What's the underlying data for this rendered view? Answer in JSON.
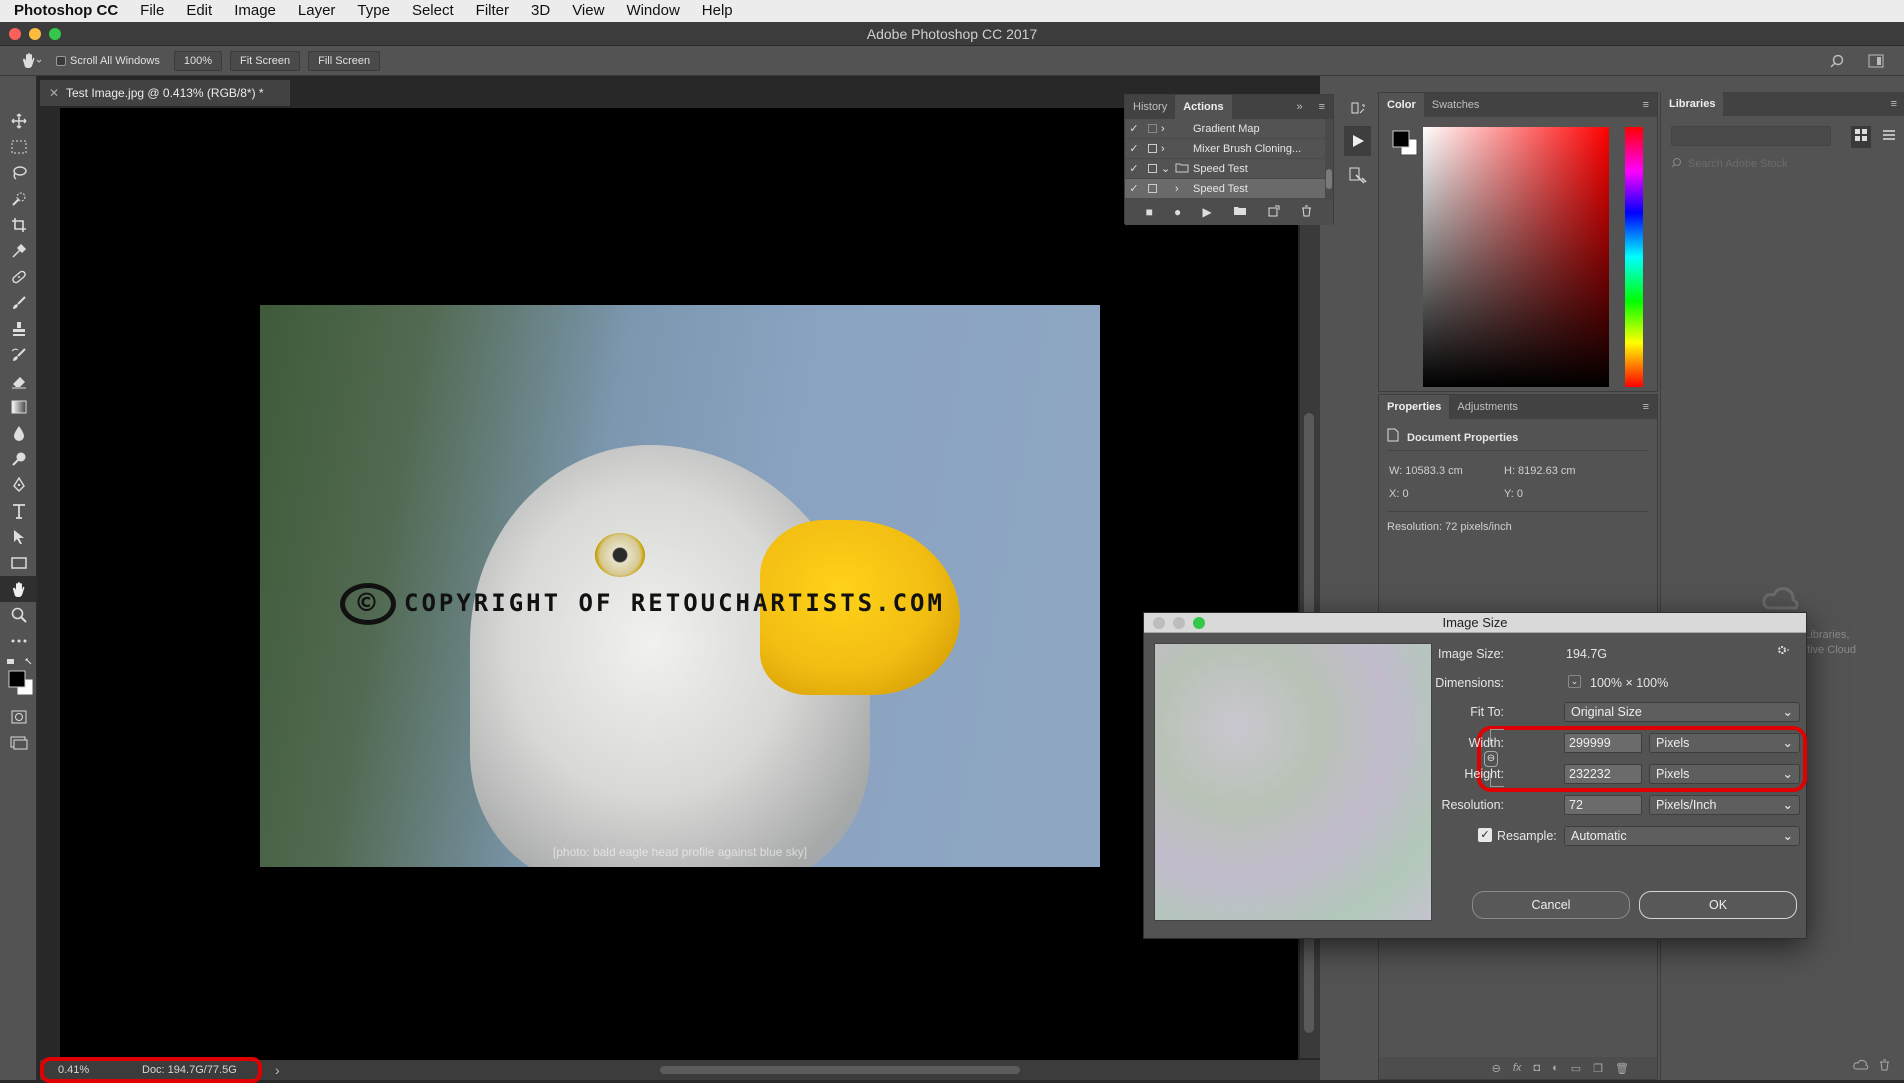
{
  "menubar": {
    "app": "Photoshop CC",
    "items": [
      "File",
      "Edit",
      "Image",
      "Layer",
      "Type",
      "Select",
      "Filter",
      "3D",
      "View",
      "Window",
      "Help"
    ]
  },
  "window": {
    "title": "Adobe Photoshop CC 2017"
  },
  "options_bar": {
    "scroll_all_windows": "Scroll All Windows",
    "zoom_100": "100%",
    "fit_screen": "Fit Screen",
    "fill_screen": "Fill Screen"
  },
  "document": {
    "tab_title": "Test Image.jpg @ 0.413% (RGB/8*) *",
    "photo_label": "[photo: bald eagle head profile against blue sky]",
    "copyright_symbol": "©",
    "copyright_text": "COPYRIGHT OF RETOUCHARTISTS.COM"
  },
  "status": {
    "zoom": "0.41%",
    "doc": "Doc: 194.7G/77.5G",
    "arrow": "›"
  },
  "actions_panel": {
    "tabs": [
      "History",
      "Actions"
    ],
    "rows": [
      {
        "label": "Gradient Map",
        "checked": true,
        "expand": "›"
      },
      {
        "label": "Mixer Brush Cloning...",
        "checked": true,
        "expand": "›"
      },
      {
        "label": "Speed Test",
        "checked": true,
        "expand": "⌄",
        "folder": true
      },
      {
        "label": "Speed Test",
        "checked": true,
        "expand": "›"
      }
    ]
  },
  "color_panel": {
    "tabs": [
      "Color",
      "Swatches"
    ]
  },
  "properties_panel": {
    "tabs": [
      "Properties",
      "Adjustments"
    ],
    "header": "Document Properties",
    "w": "W:  10583.3 cm",
    "h": "H:  8192.63 cm",
    "x": "X:  0",
    "y": "Y:  0",
    "resolution": "Resolution: 72 pixels/inch"
  },
  "libraries_panel": {
    "tab": "Libraries",
    "search_placeholder": "Search Adobe Stock",
    "cc_text_1": "d Libraries,",
    "cc_text_2": "ative Cloud"
  },
  "image_size_dialog": {
    "title": "Image Size",
    "image_size_label": "Image Size:",
    "image_size_value": "194.7G",
    "dimensions_label": "Dimensions:",
    "dimensions_value": "100%  ×  100%",
    "fit_to_label": "Fit To:",
    "fit_to_value": "Original Size",
    "width_label": "Width:",
    "width_value": "299999",
    "width_unit": "Pixels",
    "height_label": "Height:",
    "height_value": "232232",
    "height_unit": "Pixels",
    "resolution_label": "Resolution:",
    "resolution_value": "72",
    "resolution_unit": "Pixels/Inch",
    "resample_label": "Resample:",
    "resample_value": "Automatic",
    "cancel": "Cancel",
    "ok": "OK"
  },
  "colors": {
    "highlight_ring": "#e00000",
    "menubar_bg": "#ececec",
    "panel_bg": "#535353"
  }
}
